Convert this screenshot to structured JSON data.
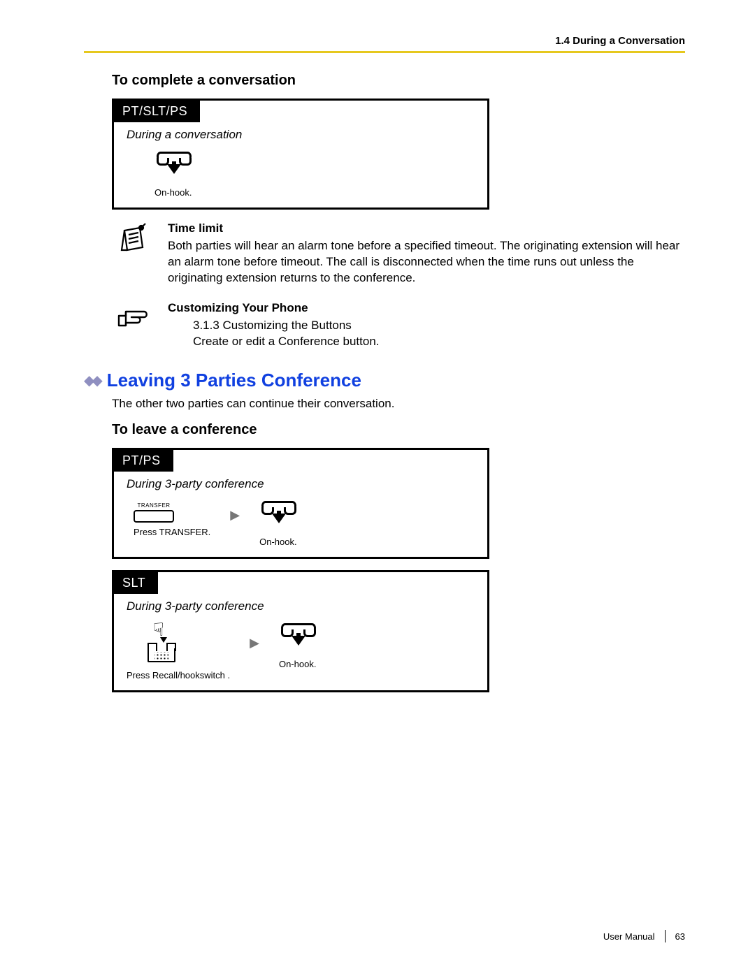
{
  "header": {
    "breadcrumb": "1.4 During a Conversation"
  },
  "section1": {
    "heading": "To complete a conversation",
    "box": {
      "tab": "PT/SLT/PS",
      "context": "During a conversation",
      "step1_caption": "On-hook."
    }
  },
  "note": {
    "title": "Time limit",
    "body": "Both parties will hear an alarm tone before a specified timeout. The originating extension will hear an alarm tone before timeout. The call is disconnected when the time runs out unless the originating extension returns to the conference."
  },
  "customize": {
    "title": "Customizing Your Phone",
    "line1": "3.1.3 Customizing the Buttons",
    "line2": "Create or edit a Conference button."
  },
  "section2": {
    "title": "Leaving 3 Parties Conference",
    "intro": "The other two parties can continue their conversation.",
    "heading": "To leave a conference",
    "boxA": {
      "tab": "PT/PS",
      "context": "During  3-party conference",
      "transfer_label": "TRANSFER",
      "step1_caption": "Press TRANSFER.",
      "step2_caption": "On-hook."
    },
    "boxB": {
      "tab": "SLT",
      "context": "During  3-party conference",
      "step1_caption": "Press Recall/hookswitch .",
      "step2_caption": "On-hook."
    }
  },
  "footer": {
    "manual": "User Manual",
    "page": "63"
  }
}
